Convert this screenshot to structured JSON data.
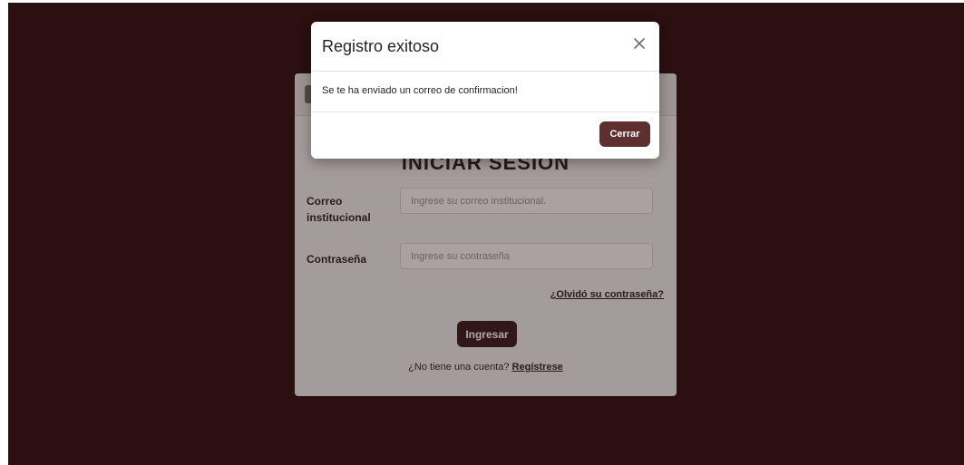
{
  "modal": {
    "title": "Registro exitoso",
    "message": "Se te ha enviado un correo de confirmacion!",
    "close_label": "Cerrar",
    "close_icon": "close-icon"
  },
  "login": {
    "title": "INICIAR SESION",
    "email_label_line1": "Correo",
    "email_label_line2": "institucional",
    "email_placeholder": "Ingrese su correo institucional.",
    "password_label": "Contraseña",
    "password_placeholder": "Ingrese su contraseña",
    "forgot_link": "¿Olvidó su contraseña?",
    "submit_label": "Ingresar",
    "no_account_text": "¿No tiene una cuenta?",
    "register_link": "Regístrese"
  },
  "colors": {
    "backdrop": "#2b0f11",
    "primary_button": "#5e2f2e",
    "login_button": "#3a1c1e"
  }
}
